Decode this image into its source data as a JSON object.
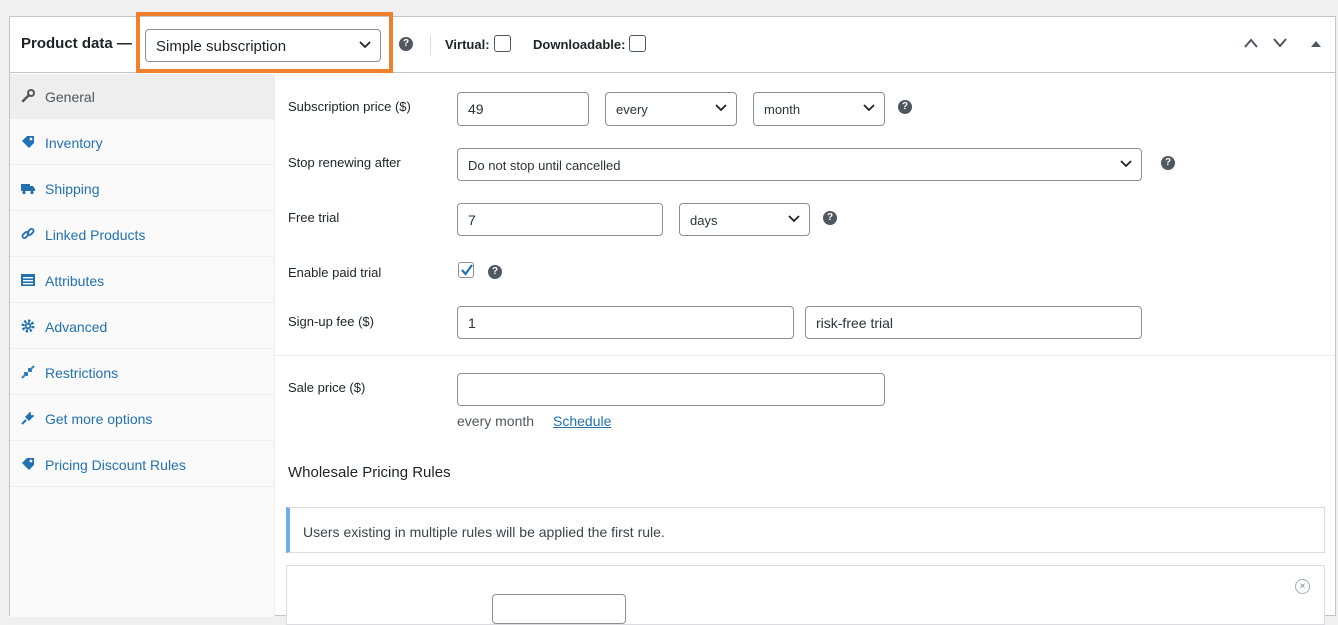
{
  "header": {
    "title": "Product data —",
    "product_type": "Simple subscription",
    "virtual_label": "Virtual:",
    "downloadable_label": "Downloadable:",
    "help_glyph": "?"
  },
  "sidebar": {
    "items": [
      {
        "label": "General",
        "icon": "wrench-icon",
        "active": true
      },
      {
        "label": "Inventory",
        "icon": "tag-icon"
      },
      {
        "label": "Shipping",
        "icon": "truck-icon"
      },
      {
        "label": "Linked Products",
        "icon": "link-icon"
      },
      {
        "label": "Attributes",
        "icon": "list-icon"
      },
      {
        "label": "Advanced",
        "icon": "gear-icon"
      },
      {
        "label": "Restrictions",
        "icon": "collapse-arrows-icon"
      },
      {
        "label": "Get more options",
        "icon": "plugin-icon"
      },
      {
        "label": "Pricing Discount Rules",
        "icon": "tag-icon"
      }
    ]
  },
  "general": {
    "subscription_price_label": "Subscription price ($)",
    "subscription_price_value": "49",
    "interval_value": "every",
    "period_value": "month",
    "stop_renewing_label": "Stop renewing after",
    "stop_renewing_value": "Do not stop until cancelled",
    "free_trial_label": "Free trial",
    "free_trial_value": "7",
    "free_trial_period": "days",
    "paid_trial_label": "Enable paid trial",
    "paid_trial_checked": true,
    "signup_fee_label": "Sign-up fee ($)",
    "signup_fee_value": "1",
    "signup_fee_note": "risk-free trial",
    "sale_price_label": "Sale price ($)",
    "sale_price_value": "",
    "sale_suffix": "every month",
    "schedule_link": "Schedule"
  },
  "wholesale": {
    "title": "Wholesale Pricing Rules",
    "notice": "Users existing in multiple rules will be applied the first rule."
  },
  "colors": {
    "highlight": "#f0802e",
    "link": "#2271b1",
    "notice_accent": "#72aee6"
  }
}
